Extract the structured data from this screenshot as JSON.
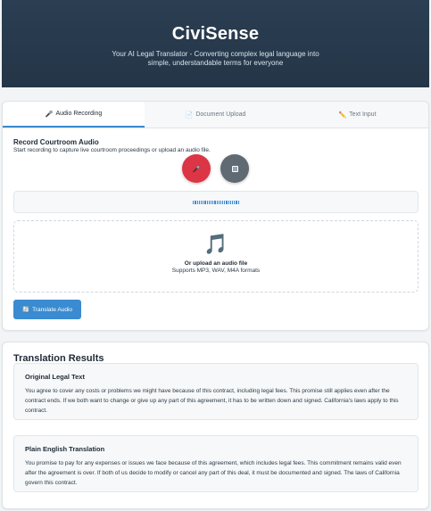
{
  "header": {
    "title": "CiviSense",
    "subtitle": "Your AI Legal Translator - Converting complex legal language into simple, understandable terms for everyone"
  },
  "tabs": [
    {
      "icon": "🎤",
      "label": "Audio Recording",
      "active": true
    },
    {
      "icon": "📄",
      "label": "Document Upload",
      "active": false
    },
    {
      "icon": "✏️",
      "label": "Text Input",
      "active": false
    }
  ],
  "recording": {
    "title": "Record Courtroom Audio",
    "description": "Start recording to capture live courtroom proceedings or upload an audio file.",
    "record_icon": "microphone-icon",
    "stop_icon": "stop-icon",
    "record_color": "#dc3545",
    "stop_color": "#5f6a72"
  },
  "upload": {
    "icon": "🎵",
    "title": "Or upload an audio file",
    "formats": "Supports MP3, WAV, M4A formats"
  },
  "translate_button": {
    "icon": "🔄",
    "label": "Translate Audio",
    "color": "#3a8bd1"
  },
  "results": {
    "title": "Translation Results",
    "original": {
      "heading": "Original Legal Text",
      "body": "You agree to cover any costs or problems we might have because of this contract, including legal fees. This promise still applies even after the contract ends. If we both want to change or give up any part of this agreement, it has to be written down and signed. California's laws apply to this contract."
    },
    "plain": {
      "heading": "Plain English Translation",
      "body": "You promise to pay for any expenses or issues we face because of this agreement, which includes legal fees. This commitment remains valid even after the agreement is over. If both of us decide to modify or cancel any part of this deal, it must be documented and signed. The laws of California govern this contract."
    }
  }
}
